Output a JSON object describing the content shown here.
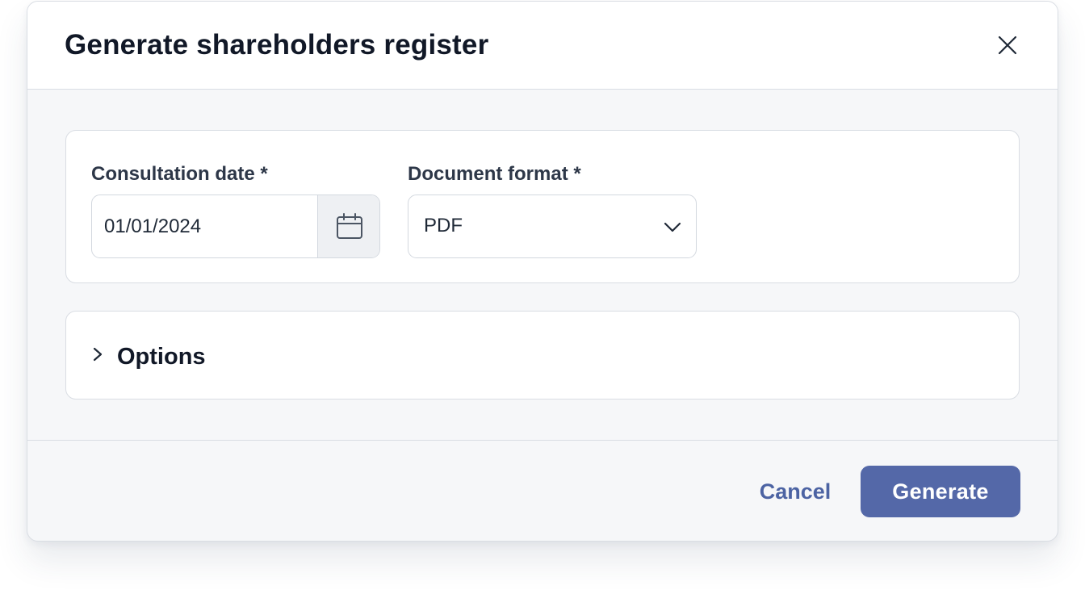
{
  "dialog": {
    "title": "Generate shareholders register",
    "close_icon": "close-icon"
  },
  "fields": {
    "consultation_date": {
      "label": "Consultation date *",
      "value": "01/01/2024",
      "icon": "calendar-icon"
    },
    "document_format": {
      "label": "Document format *",
      "selected": "PDF",
      "icon": "chevron-down-icon"
    }
  },
  "options_section": {
    "label": "Options",
    "expanded": false,
    "icon": "chevron-right-icon"
  },
  "footer": {
    "cancel_label": "Cancel",
    "generate_label": "Generate"
  },
  "colors": {
    "primary": "#5468a8",
    "link": "#4c63a3",
    "dialog_body_bg": "#f6f7f9",
    "border": "#d9dde3"
  }
}
